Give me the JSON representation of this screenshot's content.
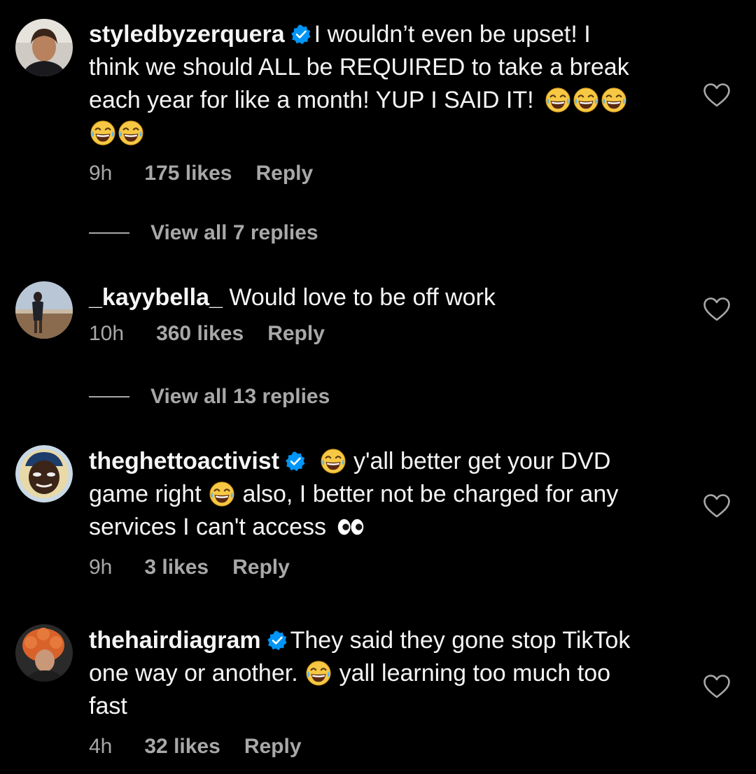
{
  "comments": [
    {
      "username": "styledbyzerquera",
      "verified": true,
      "lines": [
        "I wouldn’t even be upset! I",
        "think we should ALL be REQUIRED to take a break",
        "each year for like a month! YUP I SAID IT!"
      ],
      "time": "9h",
      "likes": "175 likes",
      "reply": "Reply",
      "view_replies": "View all 7 replies"
    },
    {
      "username": "_kayybella_",
      "verified": false,
      "text": "Would love to be off work",
      "time": "10h",
      "likes": "360 likes",
      "reply": "Reply",
      "view_replies": "View all 13 replies"
    },
    {
      "username": "theghettoactivist",
      "verified": true,
      "line1": "y'all better get your DVD",
      "line2a": "game right",
      "line2b": "also, I better not be charged for any",
      "line3": "services I can't access",
      "time": "9h",
      "likes": "3 likes",
      "reply": "Reply"
    },
    {
      "username": "thehairdiagram",
      "verified": true,
      "line1": "They said they gone stop TikTok",
      "line2a": "one way or another.",
      "line2b": "yall learning too much too",
      "line3": "fast",
      "time": "4h",
      "likes": "32 likes",
      "reply": "Reply"
    }
  ],
  "colors": {
    "background": "#000000",
    "text": "#f5f5f5",
    "secondary": "#a8a8a8",
    "verified": "#0095f6",
    "emoji": "#f7c844"
  }
}
